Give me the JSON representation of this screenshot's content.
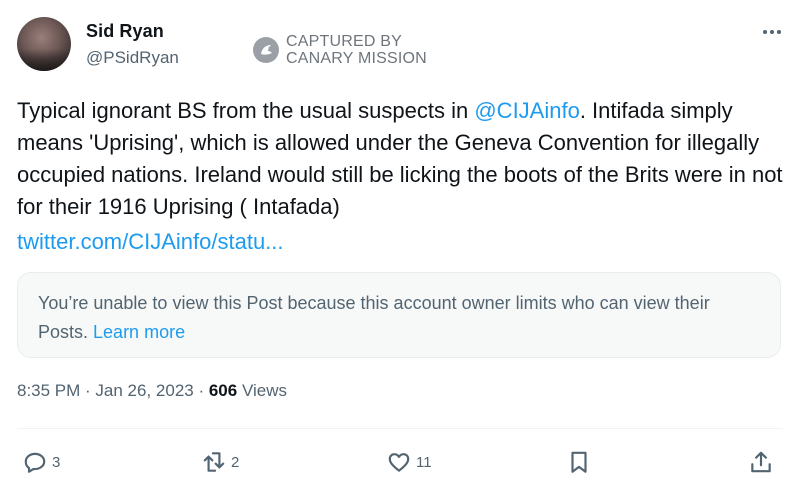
{
  "author": {
    "display_name": "Sid Ryan",
    "handle": "@PSidRyan"
  },
  "stamp": {
    "line1": "CAPTURED BY",
    "line2": "CANARY MISSION"
  },
  "post": {
    "text_before_mention": "Typical ignorant BS from the usual suspects in ",
    "mention": "@CIJAinfo",
    "text_after_mention": ". Intifada simply means 'Uprising', which is allowed under the Geneva Convention for illegally occupied nations. Ireland would still be licking the boots of the Brits were in not for their 1916 Uprising ( Intafada)",
    "link": "twitter.com/CIJAinfo/statu..."
  },
  "quoted_notice": {
    "text": "You’re unable to view this Post because this account owner limits who can view their Posts. ",
    "learn_more": "Learn more"
  },
  "meta": {
    "time": "8:35 PM",
    "date": "Jan 26, 2023",
    "separator": " · ",
    "views_count": "606",
    "views_label": " Views"
  },
  "actions": {
    "replies": "3",
    "reposts": "2",
    "likes": "11"
  },
  "icons": [
    "more-icon",
    "canary-mission-icon",
    "reply-icon",
    "repost-icon",
    "like-icon",
    "bookmark-icon",
    "share-icon"
  ],
  "colors": {
    "link": "#1d9bf0",
    "secondary_text": "#536471",
    "primary_text": "#0f1419",
    "notice_bg": "#f7f9f9"
  }
}
